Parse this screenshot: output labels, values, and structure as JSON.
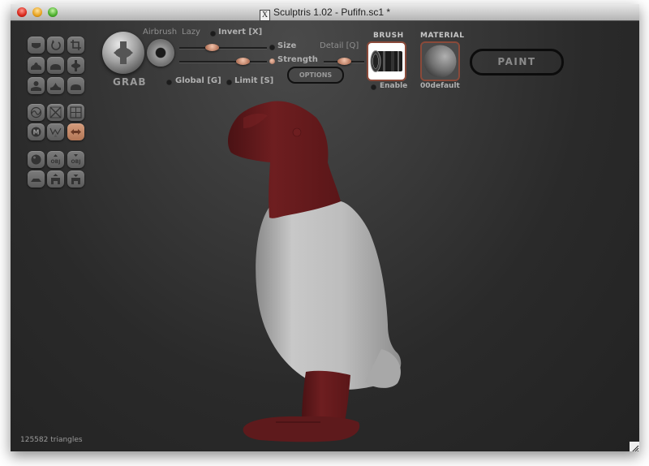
{
  "window": {
    "title": "Sculptris 1.02 - Pufifn.sc1 *",
    "app_icon": "x11-icon",
    "controls": [
      "close",
      "minimize",
      "zoom"
    ]
  },
  "toolbar": {
    "tools": [
      {
        "name": "crease",
        "icon": "crease-icon",
        "active": false
      },
      {
        "name": "rotate",
        "icon": "rotate-icon",
        "active": false
      },
      {
        "name": "scale",
        "icon": "scale-icon",
        "active": false
      },
      {
        "name": "draw",
        "icon": "draw-icon",
        "active": false
      },
      {
        "name": "inflate",
        "icon": "inflate-icon",
        "active": false
      },
      {
        "name": "pinch",
        "icon": "pinch-icon",
        "active": false
      },
      {
        "name": "flatten",
        "icon": "flatten-icon",
        "active": false
      },
      {
        "name": "smooth-peak",
        "icon": "peak-icon",
        "active": false
      },
      {
        "name": "smooth",
        "icon": "smooth-icon",
        "active": false
      },
      {
        "name": "wireframe",
        "icon": "wireframe-icon",
        "active": false
      },
      {
        "name": "reduce",
        "icon": "reduce-icon",
        "active": false
      },
      {
        "name": "grid",
        "icon": "grid-icon",
        "active": false
      },
      {
        "name": "mask",
        "icon": "mask-icon",
        "active": false
      },
      {
        "name": "reduce-brush",
        "icon": "reduce-brush-icon",
        "active": false
      },
      {
        "name": "symmetry",
        "icon": "symmetry-icon",
        "active": true
      },
      {
        "name": "sphere",
        "icon": "sphere-icon",
        "active": false
      },
      {
        "name": "import-obj",
        "icon": "import-obj-icon",
        "label": "OBJ",
        "active": false
      },
      {
        "name": "export-obj",
        "icon": "export-obj-icon",
        "label": "OBJ",
        "active": false
      },
      {
        "name": "plane",
        "icon": "plane-icon",
        "active": false
      },
      {
        "name": "open",
        "icon": "open-icon",
        "active": false
      },
      {
        "name": "save",
        "icon": "save-icon",
        "active": false
      }
    ]
  },
  "brush_panel": {
    "current_tool": "GRAB",
    "airbrush_label": "Airbrush",
    "lazy_label": "Lazy",
    "invert_label": "Invert [X]",
    "invert_on": false,
    "size_label": "Size",
    "size_value": 0.35,
    "size_on": false,
    "strength_label": "Strength",
    "strength_value": 0.77,
    "strength_on": true,
    "detail_label": "Detail [Q]",
    "detail_value": 0.5,
    "global_label": "Global [G]",
    "global_on": false,
    "limit_label": "Limit [S]",
    "limit_on": false,
    "options_label": "OPTIONS"
  },
  "brush": {
    "title": "BRUSH",
    "enable_label": "Enable",
    "enabled": false
  },
  "material": {
    "title": "MATERIAL",
    "name": "00default"
  },
  "paint_button": "PAINT",
  "status": {
    "triangles": "125582 triangles"
  },
  "colors": {
    "accent": "#c8876a",
    "model_red": "#6a1c1e",
    "model_white": "#c4c4c4",
    "viewport_bg": "#2a2a2a"
  }
}
